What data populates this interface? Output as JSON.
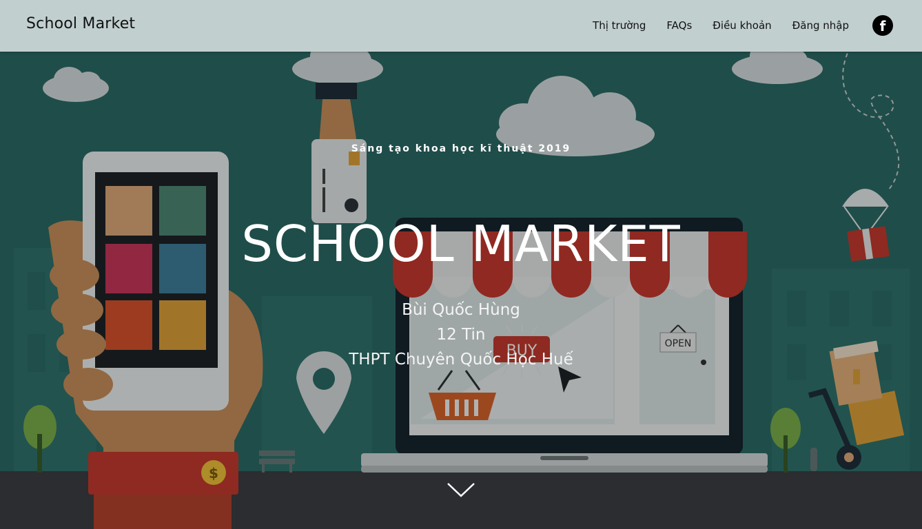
{
  "navbar": {
    "brand": "School Market",
    "links": [
      "Thị trường",
      "FAQs",
      "Điều khoản",
      "Đăng nhập"
    ],
    "social_icon": "facebook-icon",
    "social_glyph": "f"
  },
  "hero": {
    "kicker": "Sáng tạo khoa học kĩ thuật 2019",
    "title": "SCHOOL MARKET",
    "author": "Bùi Quốc Hùng",
    "class": "12 Tin",
    "school": "THPT Chuyên Quốc Học Huế",
    "scroll_icon": "chevron-down-icon",
    "illustration": {
      "buy_label": "BUY",
      "open_label": "OPEN",
      "coin_label": "$"
    }
  },
  "colors": {
    "navbar_bg": "#c2cfcf",
    "hero_bg": "#2a6a66",
    "awning_red": "#c83a2e",
    "text": "#ffffff"
  }
}
